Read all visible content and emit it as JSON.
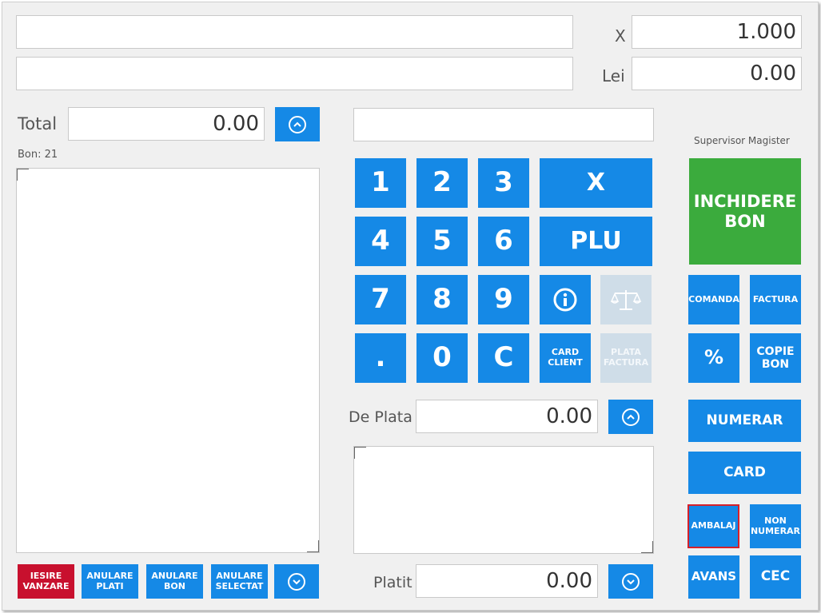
{
  "top": {
    "qty_label": "X",
    "qty_value": "1.000",
    "price_label": "Lei",
    "price_value": "0.00"
  },
  "left": {
    "total_label": "Total",
    "total_value": "0.00",
    "bon_label": "Bon: 21"
  },
  "bottom_left_buttons": {
    "iesire": "IESIRE\nVANZARE",
    "anulare_plati": "ANULARE\nPLATI",
    "anulare_bon": "ANULARE\nBON",
    "anulare_selectat": "ANULARE\nSELECTAT"
  },
  "keypad": {
    "k1": "1",
    "k2": "2",
    "k3": "3",
    "k4": "4",
    "k5": "5",
    "k6": "6",
    "k7": "7",
    "k8": "8",
    "k9": "9",
    "kdot": ".",
    "k0": "0",
    "kc": "C",
    "x": "X",
    "plu": "PLU",
    "card_client": "CARD\nCLIENT",
    "plata_factura": "PLATA\nFACTURA"
  },
  "middle": {
    "de_plata_label": "De Plata",
    "de_plata_value": "0.00",
    "platit_label": "Platit",
    "platit_value": "0.00"
  },
  "right": {
    "user_name": "Supervisor Magister",
    "inchidere_bon": "INCHIDERE\nBON",
    "comanda": "COMANDA",
    "factura": "FACTURA",
    "percent": "%",
    "copie_bon": "COPIE\nBON",
    "numerar": "NUMERAR",
    "card": "CARD",
    "ambalaj": "AMBALAJ",
    "non_numerar": "NON\nNUMERAR",
    "avans": "AVANS",
    "cec": "CEC"
  },
  "colors": {
    "accent": "#1589e6",
    "close_receipt": "#3bab3d",
    "exit_sale": "#c8102e",
    "disabled": "#cfdde8",
    "selected_outline": "#d6202a"
  },
  "icons": {
    "total_toggle": "chevron-up-circle-icon",
    "de_plata_toggle": "chevron-up-circle-icon",
    "platit_toggle": "chevron-down-circle-icon",
    "list_toggle": "chevron-down-circle-icon",
    "info": "info-circle-icon",
    "scale": "scale-icon"
  }
}
